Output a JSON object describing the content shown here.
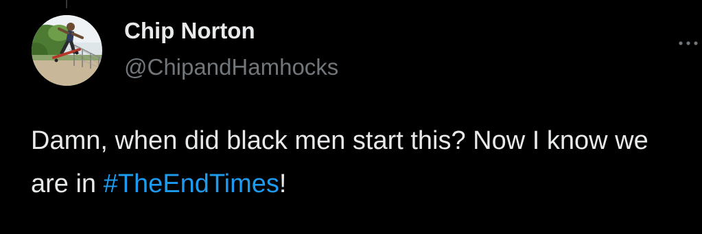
{
  "author": {
    "display_name": "Chip Norton",
    "handle": "@ChipandHamhocks",
    "avatar_icon": "profile-photo-skateboarder"
  },
  "menu": {
    "icon": "more-options-icon"
  },
  "tweet": {
    "text_before": "Damn, when did black men start this? Now I know we are in ",
    "hashtag": "#TheEndTimes",
    "text_after": "!"
  },
  "colors": {
    "background": "#000000",
    "text": "#e7e9ea",
    "secondary_text": "#71767b",
    "link": "#1d9bf0"
  }
}
